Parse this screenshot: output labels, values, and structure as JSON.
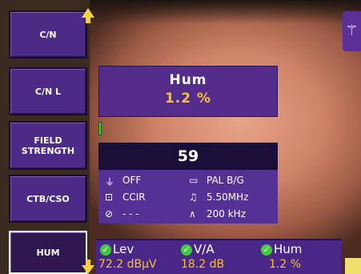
{
  "menu": [
    {
      "label": "C/N"
    },
    {
      "label": "C/N L"
    },
    {
      "label": "FIELD\nSTRENGTH"
    },
    {
      "label": "CTB/CSO"
    },
    {
      "label": "HUM"
    }
  ],
  "measurement": {
    "title": "Hum",
    "value": "1.2 %"
  },
  "channel": "59",
  "info": {
    "power": "OFF",
    "standard": "PAL B/G",
    "channel_plan": "CCIR",
    "audio": "5.50MHz",
    "colour": "- - -",
    "bandwidth": "200 kHz"
  },
  "bottom_measurements": [
    {
      "label": "Lev",
      "value": "72.2 dBµV"
    },
    {
      "label": "V/A",
      "value": "18.2 dB"
    },
    {
      "label": "Hum",
      "value": "1.2 %"
    }
  ],
  "icons": {
    "scroll_up": "arrow-up-icon",
    "scroll_down": "arrow-down-icon",
    "antenna": "antenna-icon",
    "check": "check-icon"
  },
  "colors": {
    "menu": "#4d2a86",
    "value": "#f7c13a",
    "ok": "#41c940"
  }
}
